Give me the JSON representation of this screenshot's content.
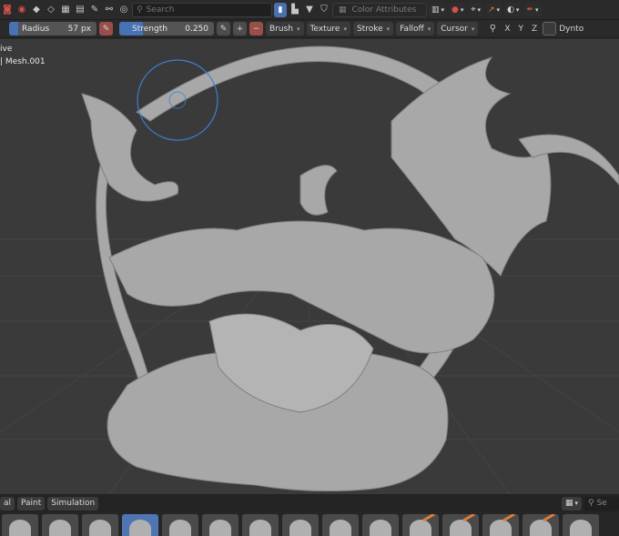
{
  "header1": {
    "search_placeholder": "Search",
    "color_attributes_placeholder": "Color Attributes"
  },
  "tool_header": {
    "radius_label": "Radius",
    "radius_value": "57 px",
    "strength_label": "Strength",
    "strength_value": "0.250",
    "menus": [
      "Brush",
      "Texture",
      "Stroke",
      "Falloff",
      "Cursor"
    ],
    "axes": [
      "X",
      "Y",
      "Z"
    ],
    "dyntopo_label": "Dynto"
  },
  "viewport": {
    "mode_text": "ive",
    "object_text": "| Mesh.001"
  },
  "bottom_tabs": [
    "al",
    "Paint",
    "Simulation"
  ],
  "bottom_search_placeholder": "Se",
  "colors": {
    "accent_blue": "#4772b3",
    "active_red": "#9a4e4a",
    "background": "#3a3a3a"
  }
}
